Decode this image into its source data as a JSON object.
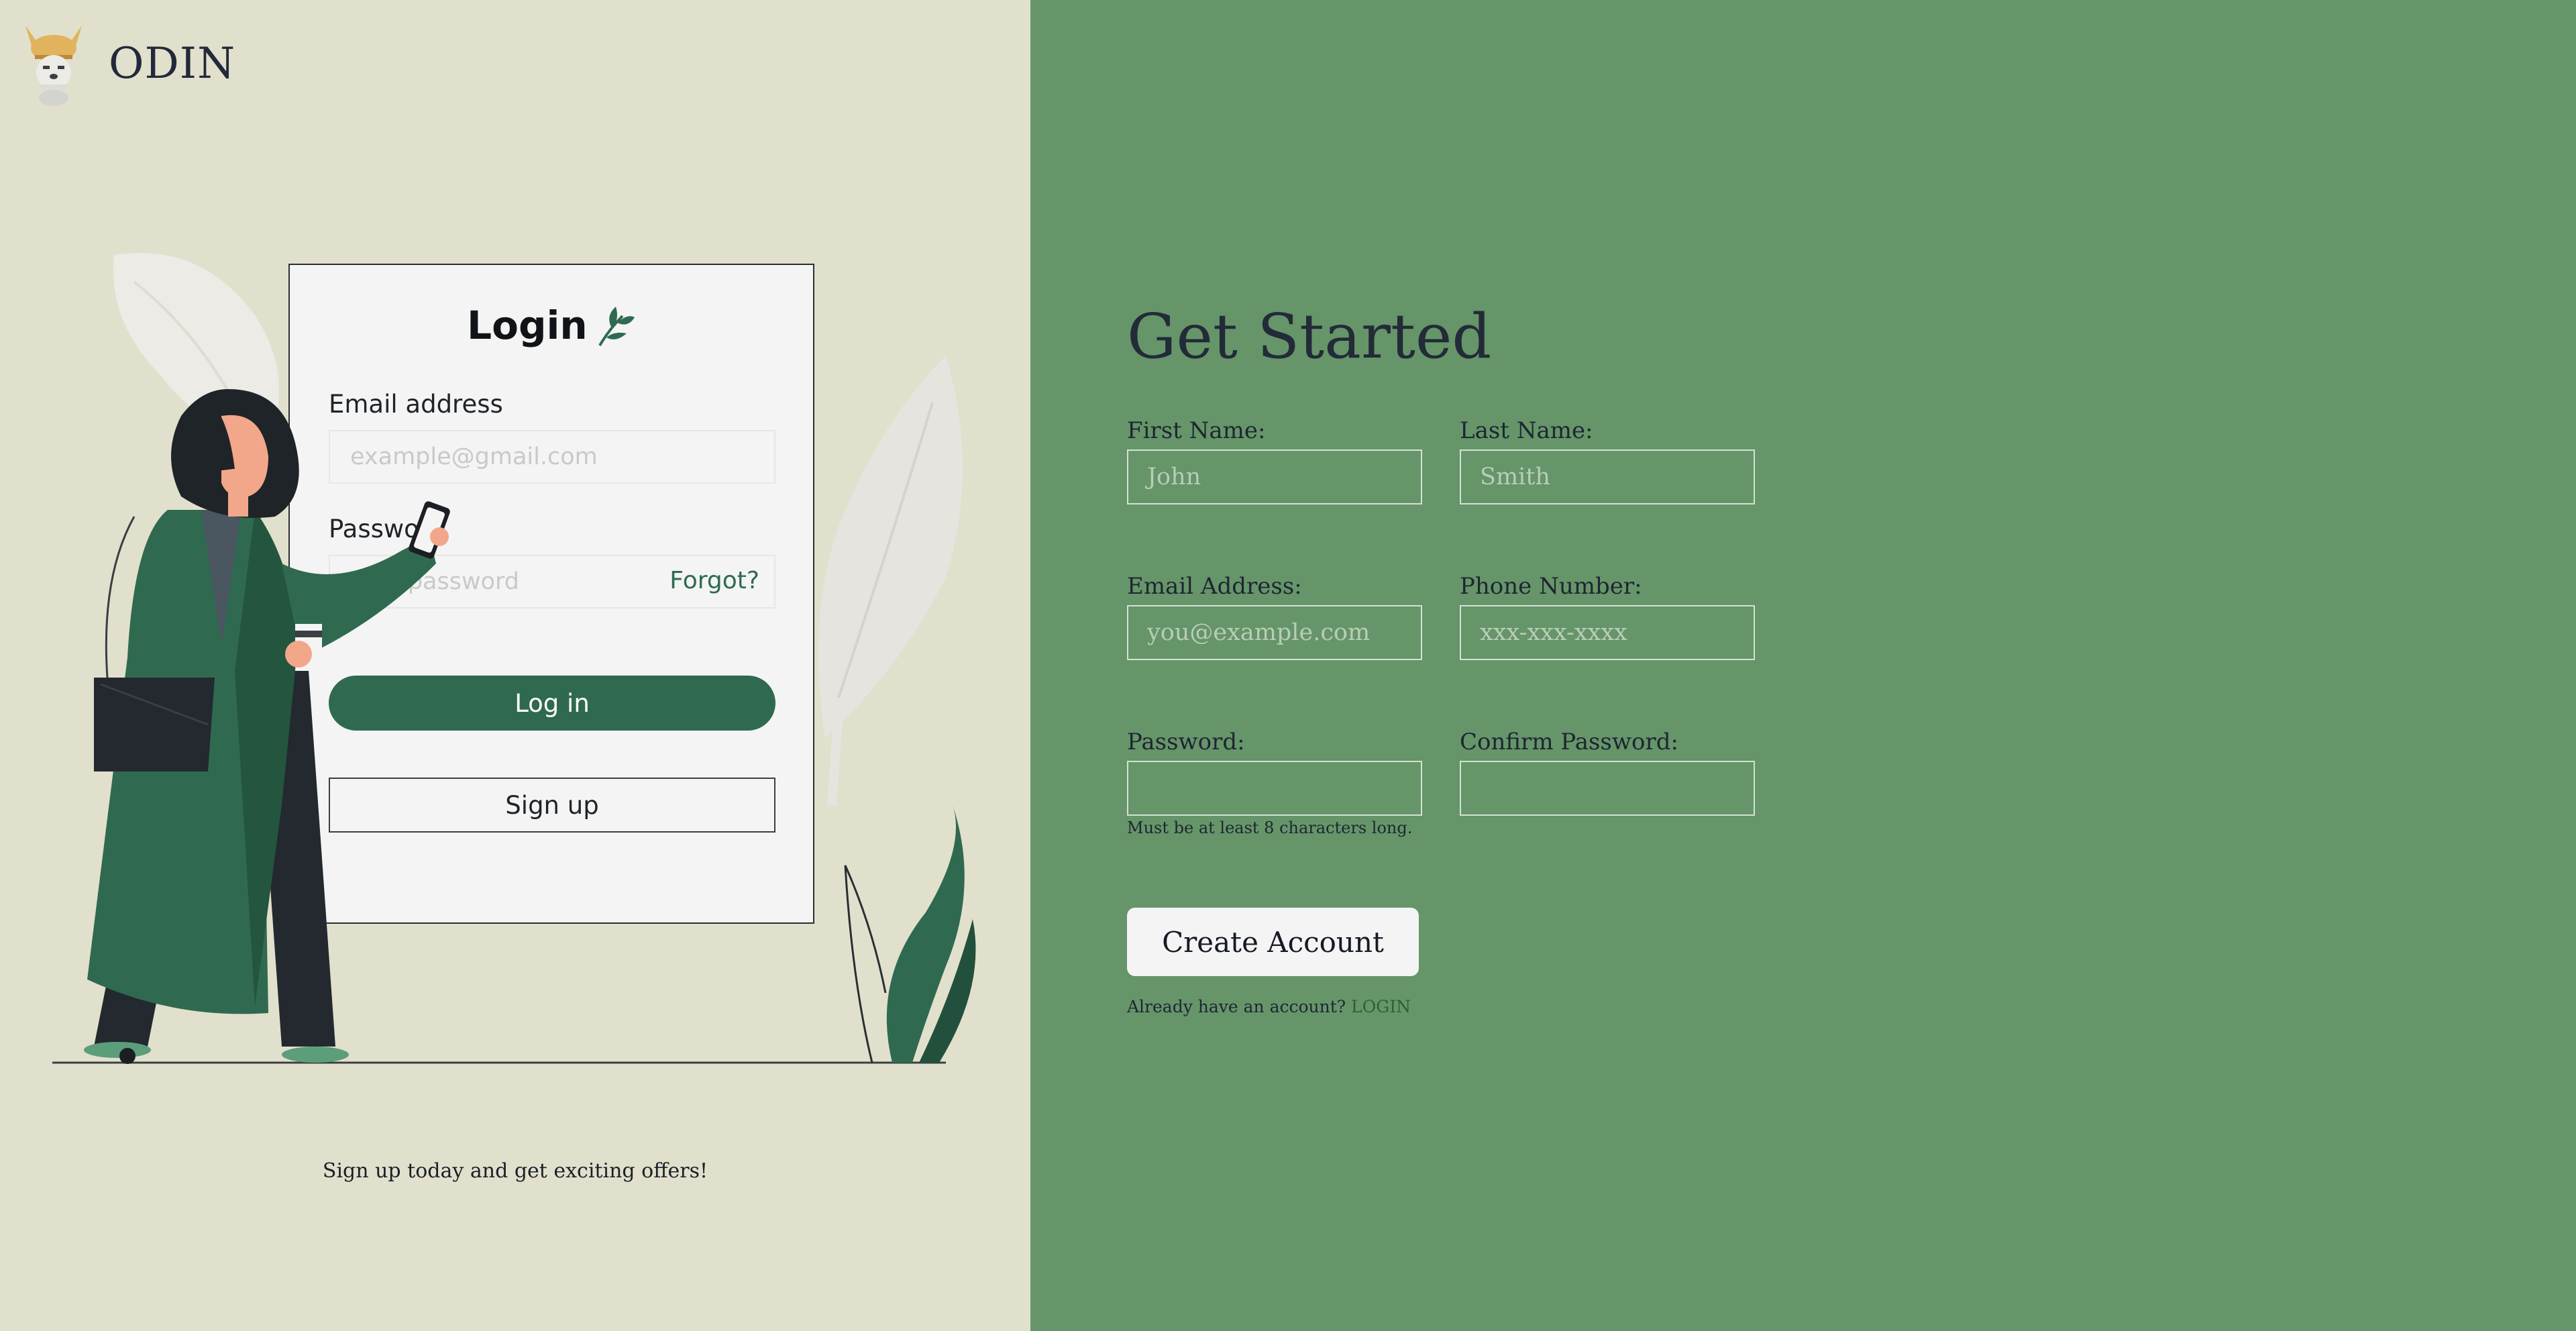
{
  "brand": {
    "name": "ODIN",
    "logo_icon": "viking-dog-logo-icon"
  },
  "login_card": {
    "title": "Login",
    "email_label": "Email address",
    "email_placeholder": "example@gmail.com",
    "password_label": "Password",
    "password_placeholder": "Your password",
    "forgot_label": "Forgot?",
    "login_button": "Log in",
    "signup_button": "Sign up"
  },
  "tagline": "Sign up today and get exciting offers!",
  "form": {
    "title": "Get Started",
    "first_name_label": "First Name:",
    "first_name_placeholder": "John",
    "last_name_label": "Last Name:",
    "last_name_placeholder": "Smith",
    "email_label": "Email Address:",
    "email_placeholder": "you@example.com",
    "phone_label": "Phone Number:",
    "phone_placeholder": "xxx-xxx-xxxx",
    "password_label": "Password:",
    "confirm_password_label": "Confirm Password:",
    "password_hint": "Must be at least 8 characters long.",
    "create_button": "Create Account",
    "already_text": "Already have an account?",
    "login_link": "LOGIN"
  },
  "colors": {
    "left_panel": "#e1e0cc",
    "right_panel": "#659569",
    "accent_green": "#2f6a50",
    "text_dark": "#232a38"
  }
}
